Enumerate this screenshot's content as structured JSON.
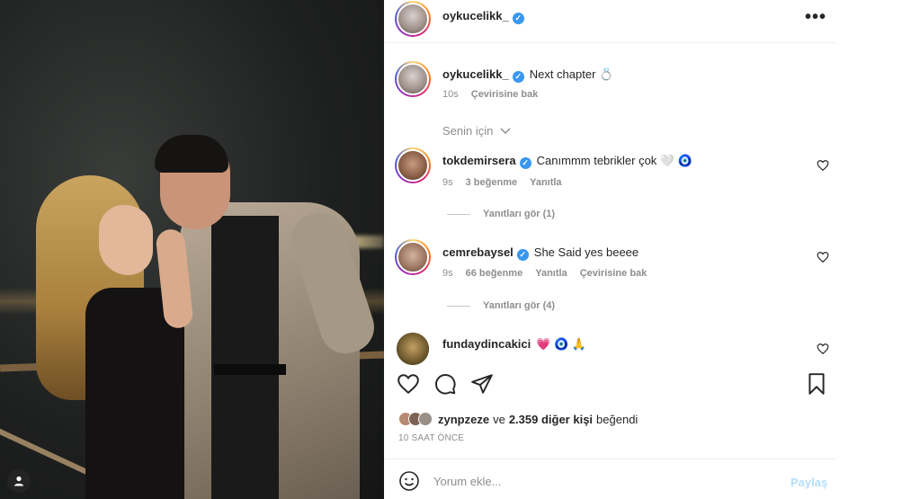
{
  "header": {
    "username": "oykucelikk_",
    "more_icon": "more-horizontal-icon"
  },
  "caption": {
    "username": "oykucelikk_",
    "text": "Next chapter 💍",
    "time": "10s",
    "translate": "Çevirisine bak"
  },
  "filter_label": "Senin için",
  "comments": [
    {
      "username": "tokdemirsera",
      "text": "Canımmm tebrikler çok 🤍 🧿",
      "time": "9s",
      "likes": "3 beğenme",
      "reply": "Yanıtla",
      "view_replies": "Yanıtları gör (1)"
    },
    {
      "username": "cemrebaysel",
      "text": "She Said yes beeee",
      "time": "9s",
      "likes": "66 beğenme",
      "reply": "Yanıtla",
      "translate": "Çevirisine bak",
      "view_replies": "Yanıtları gör (4)"
    },
    {
      "username": "fundaydincakici",
      "text": "💗 🧿 🙏"
    }
  ],
  "likes": {
    "user": "zynpzeze",
    "connector": "ve",
    "others": "2.359 diğer kişi",
    "suffix": "beğendi"
  },
  "time_ago": "10 SAAT ÖNCE",
  "comment_box": {
    "placeholder": "Yorum ekle...",
    "post_label": "Paylaş"
  },
  "colors": {
    "verified": "#3897f0",
    "muted": "#8e8e8e",
    "post_disabled": "#b2dffc"
  }
}
